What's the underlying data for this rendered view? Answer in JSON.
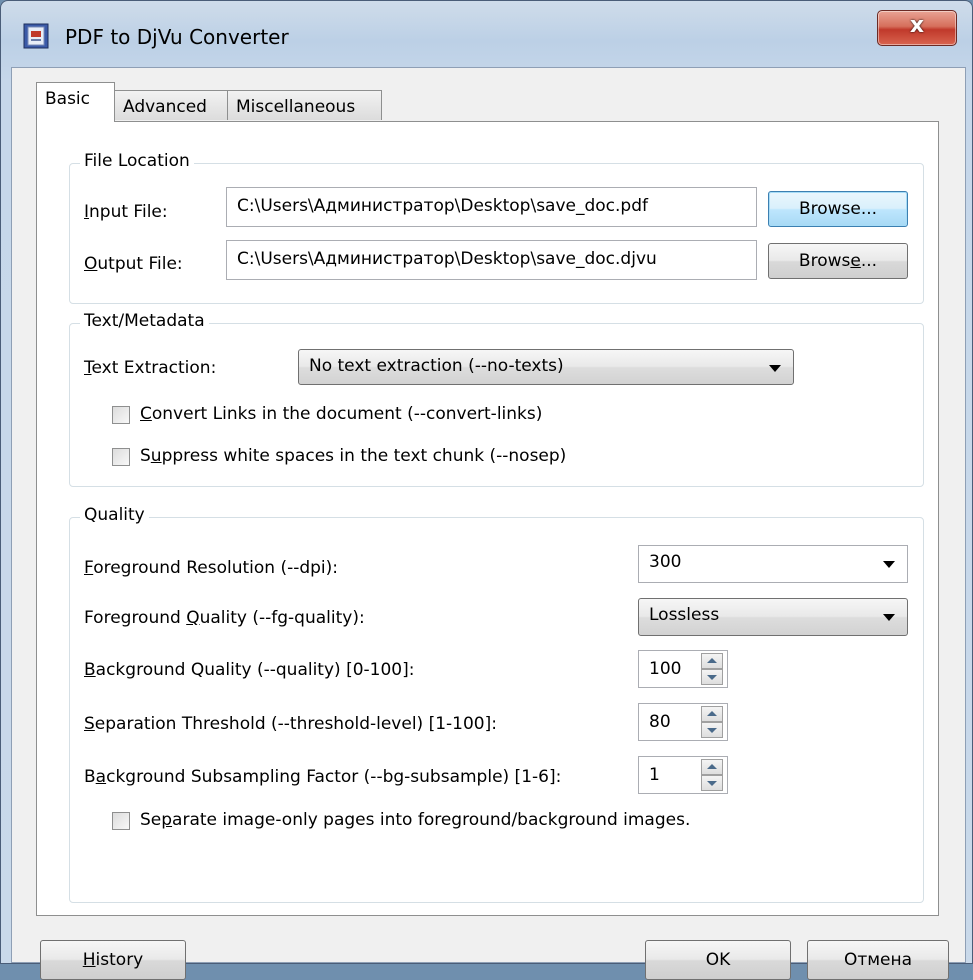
{
  "window": {
    "title": "PDF to DjVu Converter",
    "close_symbol": "x"
  },
  "tabs": [
    {
      "label": "Basic",
      "active": true
    },
    {
      "label": "Advanced",
      "active": false
    },
    {
      "label": "Miscellaneous",
      "active": false
    }
  ],
  "file_location": {
    "group_title": "File Location",
    "input_label_mn": "I",
    "input_label_rest": "nput File:",
    "input_value": "C:\\Users\\Администратор\\Desktop\\save_doc.pdf",
    "input_browse": "Browse...",
    "output_label_mn": "O",
    "output_label_rest": "utput File:",
    "output_value": "C:\\Users\\Администратор\\Desktop\\save_doc.djvu",
    "output_browse_a": "Brows",
    "output_browse_mn": "e",
    "output_browse_b": "..."
  },
  "text_metadata": {
    "group_title": "Text/Metadata",
    "extraction_label_mn": "T",
    "extraction_label_rest": "ext Extraction:",
    "extraction_value": "No text extraction (--no-texts)",
    "convert_links_mn": "C",
    "convert_links_rest": "onvert Links in the document (--convert-links)",
    "convert_links_checked": false,
    "suppress_a": "S",
    "suppress_mn": "u",
    "suppress_rest": "ppress white spaces in the text chunk (--nosep)",
    "suppress_checked": false
  },
  "quality": {
    "group_title": "Quality",
    "fg_res_mn": "F",
    "fg_res_rest": "oreground Resolution (--dpi):",
    "fg_res_value": "300",
    "fg_quality_a": "Foreground ",
    "fg_quality_mn": "Q",
    "fg_quality_rest": "uality (--fg-quality):",
    "fg_quality_value": "Lossless",
    "bg_quality_mn": "B",
    "bg_quality_rest": "ackground Quality (--quality) [0-100]:",
    "bg_quality_value": "100",
    "sep_threshold_mn": "S",
    "sep_threshold_rest": "eparation Threshold (--threshold-level) [1-100]:",
    "sep_threshold_value": "80",
    "bg_subsample_a": "B",
    "bg_subsample_mn": "a",
    "bg_subsample_rest": "ckground Subsampling Factor (--bg-subsample) [1-6]:",
    "bg_subsample_value": "1",
    "separate_a": "Se",
    "separate_mn": "p",
    "separate_rest": "arate image-only pages into foreground/background images.",
    "separate_checked": false
  },
  "footer": {
    "history_mn": "H",
    "history_rest": "istory",
    "ok": "OK",
    "cancel": "Отмена"
  }
}
